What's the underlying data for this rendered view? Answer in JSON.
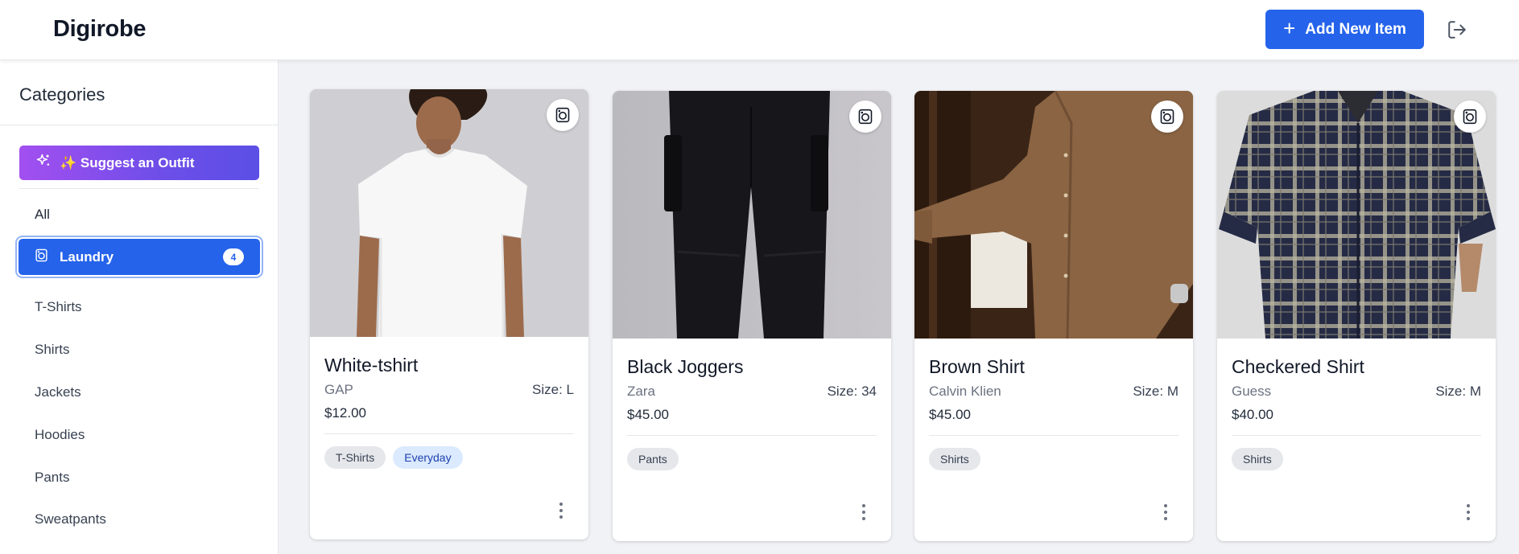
{
  "app": {
    "title": "Digirobe"
  },
  "header": {
    "add_button_label": "Add New Item",
    "add_icon": "plus-icon",
    "logout_icon": "logout-icon"
  },
  "sidebar": {
    "title": "Categories",
    "suggest_label": "✨ Suggest an Outfit",
    "all_label": "All",
    "laundry": {
      "label": "Laundry",
      "count": "4"
    },
    "items": [
      {
        "label": "T-Shirts"
      },
      {
        "label": "Shirts"
      },
      {
        "label": "Jackets"
      },
      {
        "label": "Hoodies"
      },
      {
        "label": "Pants"
      },
      {
        "label": "Sweatpants"
      }
    ]
  },
  "items": [
    {
      "name": "White-tshirt",
      "brand": "GAP",
      "size": "Size: L",
      "price": "$12.00",
      "tags": [
        {
          "label": "T-Shirts",
          "variant": "gray"
        },
        {
          "label": "Everyday",
          "variant": "blue"
        }
      ]
    },
    {
      "name": "Black Joggers",
      "brand": "Zara",
      "size": "Size: 34",
      "price": "$45.00",
      "tags": [
        {
          "label": "Pants",
          "variant": "gray"
        }
      ]
    },
    {
      "name": "Brown Shirt",
      "brand": "Calvin Klien",
      "size": "Size: M",
      "price": "$45.00",
      "tags": [
        {
          "label": "Shirts",
          "variant": "gray"
        }
      ]
    },
    {
      "name": "Checkered Shirt",
      "brand": "Guess",
      "size": "Size: M",
      "price": "$40.00",
      "tags": [
        {
          "label": "Shirts",
          "variant": "gray"
        }
      ]
    }
  ],
  "colors": {
    "primary": "#2563eb",
    "suggest_start": "#a34ff0",
    "suggest_end": "#5b4fe6",
    "tag_gray": "#e5e7eb",
    "tag_blue": "#dbeafe"
  }
}
